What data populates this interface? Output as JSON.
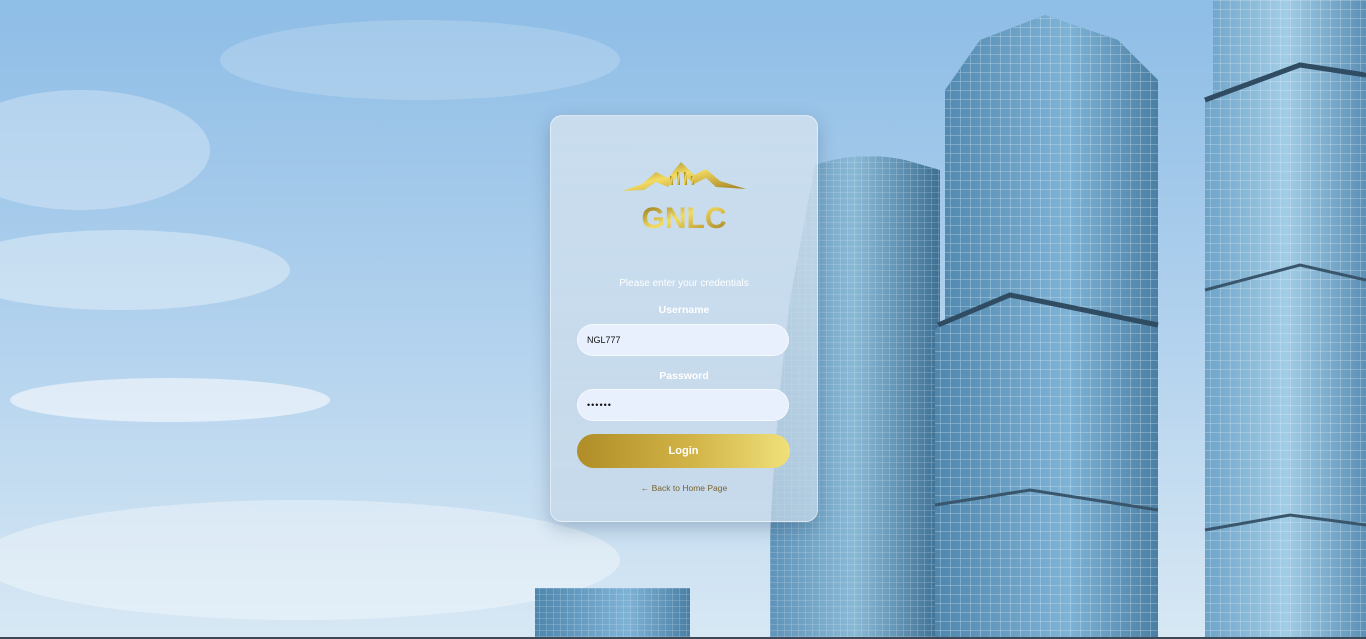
{
  "brand": {
    "name": "GNLC",
    "accent_gold": "#c9a73a"
  },
  "login": {
    "subtitle": "Please enter your credentials",
    "username_label": "Username",
    "username_value": "NGL777",
    "password_label": "Password",
    "password_value": "••••••",
    "submit_label": "Login",
    "back_link": "← Back to Home Page"
  },
  "colors": {
    "input_bg": "#e8effd",
    "button_gradient_start": "#b08d27",
    "button_gradient_end": "#f0e07a",
    "link_color": "#7a6430"
  }
}
